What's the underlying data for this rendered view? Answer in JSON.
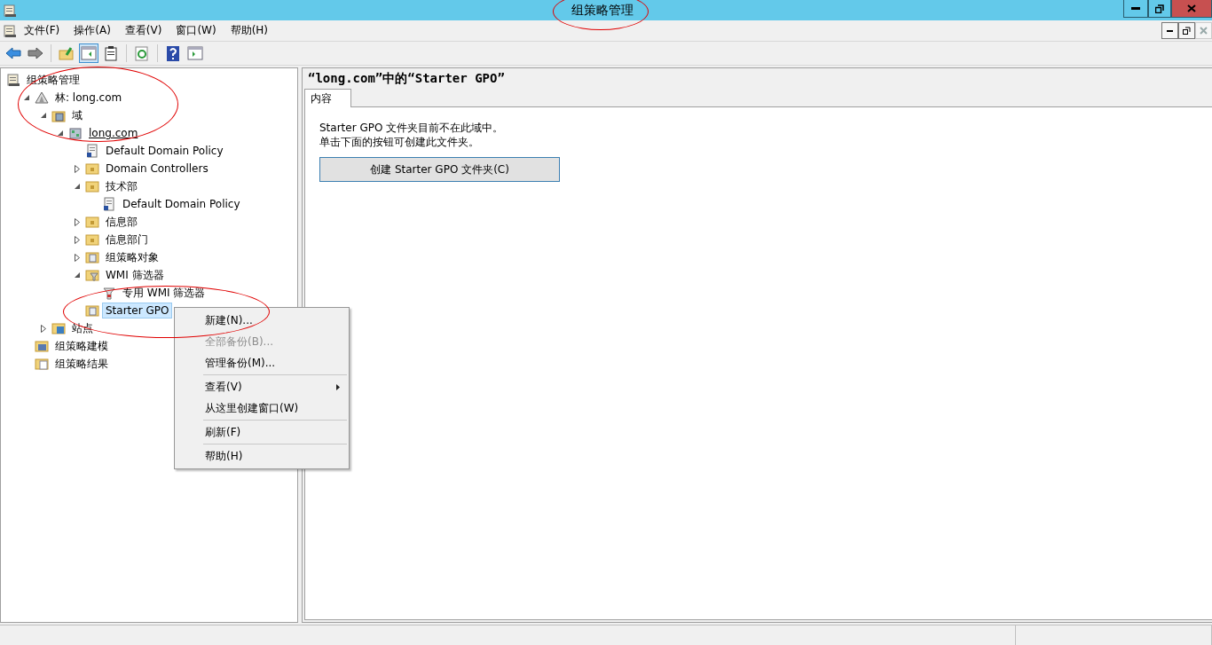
{
  "window": {
    "title": "组策略管理"
  },
  "menu_bar": [
    "文件(F)",
    "操作(A)",
    "查看(V)",
    "窗口(W)",
    "帮助(H)"
  ],
  "toolbar": [
    {
      "kind": "back",
      "selected": false
    },
    {
      "kind": "forward",
      "selected": false
    },
    {
      "kind": "up",
      "selected": false
    },
    {
      "kind": "pane",
      "selected": true
    },
    {
      "kind": "clipboard",
      "selected": false
    },
    {
      "kind": "refresh",
      "selected": false
    },
    {
      "kind": "help",
      "selected": false
    },
    {
      "kind": "panel",
      "selected": false
    }
  ],
  "tree": [
    {
      "label": "组策略管理",
      "kind": "console",
      "selected": false,
      "children": [
        {
          "label": "林: long.com",
          "kind": "forest",
          "expanded": true,
          "selected": false,
          "children": [
            {
              "label": "域",
              "kind": "domains",
              "expanded": true,
              "selected": false,
              "children": [
                {
                  "label": "long.com",
                  "kind": "domain",
                  "expanded": true,
                  "selected": false,
                  "underline": true,
                  "children": [
                    {
                      "label": "Default Domain Policy",
                      "kind": "gpo",
                      "selected": false
                    },
                    {
                      "label": "Domain Controllers",
                      "kind": "ou",
                      "expanded": false,
                      "selected": false
                    },
                    {
                      "label": "技术部",
                      "kind": "ou",
                      "expanded": true,
                      "selected": false,
                      "children": [
                        {
                          "label": "Default Domain Policy",
                          "kind": "gpo",
                          "selected": false
                        }
                      ]
                    },
                    {
                      "label": "信息部",
                      "kind": "ou",
                      "expanded": false,
                      "selected": false
                    },
                    {
                      "label": "信息部门",
                      "kind": "ou",
                      "expanded": false,
                      "selected": false
                    },
                    {
                      "label": "组策略对象",
                      "kind": "folder",
                      "expanded": false,
                      "selected": false
                    },
                    {
                      "label": "WMI 筛选器",
                      "kind": "filterfolder",
                      "expanded": true,
                      "selected": false,
                      "children": [
                        {
                          "label": "专用 WMI 筛选器",
                          "kind": "filter",
                          "selected": false
                        }
                      ]
                    },
                    {
                      "label": "Starter GPO",
                      "kind": "folder",
                      "selected": true
                    }
                  ]
                }
              ]
            },
            {
              "label": "站点",
              "kind": "sites",
              "expanded": false,
              "selected": false
            }
          ]
        },
        {
          "label": "组策略建模",
          "kind": "modeling",
          "selected": false
        },
        {
          "label": "组策略结果",
          "kind": "results",
          "selected": false
        }
      ]
    }
  ],
  "content": {
    "heading": "“long.com”中的“Starter GPO”",
    "tabs": [
      {
        "label": "内容",
        "selected": true
      }
    ],
    "lines": [
      "Starter GPO 文件夹目前不在此域中。",
      "单击下面的按钮可创建此文件夹。"
    ],
    "button": "创建 Starter GPO 文件夹(C)"
  },
  "context_menu": [
    {
      "kind": "item",
      "label": "新建(N)...",
      "disabled": false,
      "submenu": false
    },
    {
      "kind": "item",
      "label": "全部备份(B)...",
      "disabled": true,
      "submenu": false
    },
    {
      "kind": "item",
      "label": "管理备份(M)...",
      "disabled": false,
      "submenu": false
    },
    {
      "kind": "separator"
    },
    {
      "kind": "item",
      "label": "查看(V)",
      "disabled": false,
      "submenu": true
    },
    {
      "kind": "item",
      "label": "从这里创建窗口(W)",
      "disabled": false,
      "submenu": false
    },
    {
      "kind": "separator"
    },
    {
      "kind": "item",
      "label": "刷新(F)",
      "disabled": false,
      "submenu": false
    },
    {
      "kind": "separator"
    },
    {
      "kind": "item",
      "label": "帮助(H)",
      "disabled": false,
      "submenu": false
    }
  ]
}
